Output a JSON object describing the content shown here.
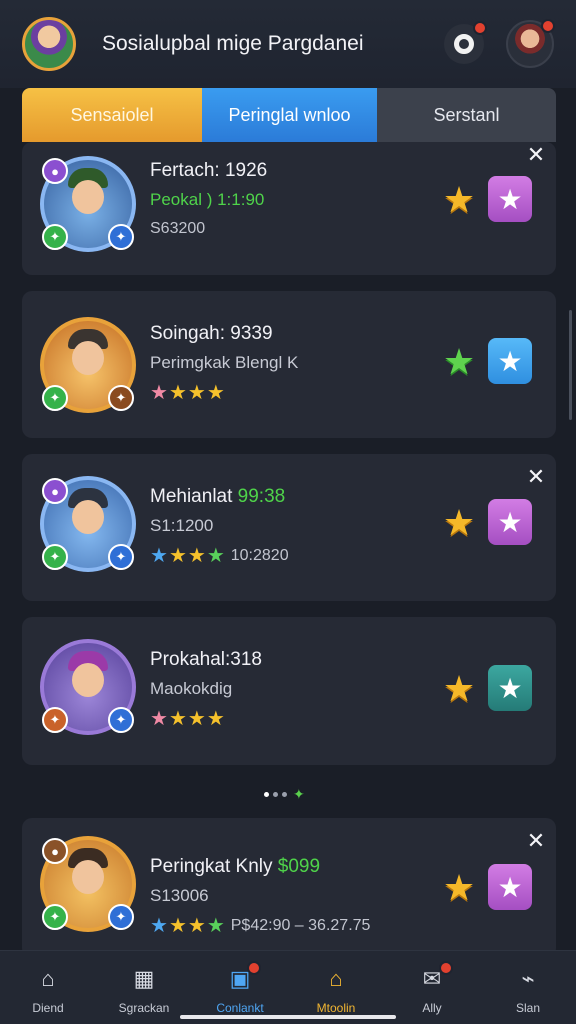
{
  "header": {
    "title": "Sosialupbal mige Pargdanei",
    "avatar_icon": "hero-avatar-icon",
    "settings_icon": "gear-icon",
    "profile_icon": "profile-avatar-icon"
  },
  "tabs": [
    {
      "label": "Sensaiolel"
    },
    {
      "label": "Peringlal wnloo"
    },
    {
      "label": "Serstanl"
    }
  ],
  "cards": [
    {
      "line1": "Fertach: 1926",
      "line2": "Peokal ) 1:1:90",
      "line3_text": "S63200",
      "action_icon": "gold-star-icon",
      "fav_color": "#b85fd4",
      "has_close": true
    },
    {
      "line1": "Soingah: 9339",
      "line2": "Perimgkak Blengl K",
      "line3_text": "",
      "action_icon": "green-star-icon",
      "fav_color": "#3a9eea",
      "has_close": false
    },
    {
      "line1_prefix": "Mehianlat ",
      "line1_green": "99:38",
      "line2": "S1:1200",
      "line3_text": "10:2820",
      "action_icon": "gold-star-icon",
      "fav_color": "#b85fd4",
      "has_close": true
    },
    {
      "line1": "Prokahal:318",
      "line2": "Maokokdig",
      "line3_text": "",
      "action_icon": "gold-star-icon",
      "fav_color": "#2f8f8a",
      "has_close": false
    },
    {
      "line1_prefix": "Peringkat Knly ",
      "line1_green": "$099",
      "line2": "S13006",
      "line3_text": "P$42:90 – 36.27.75",
      "action_icon": "gold-star-icon",
      "fav_color": "#b85fd4",
      "has_close": true
    }
  ],
  "pager": {
    "pages": 3,
    "active": 0
  },
  "nav": [
    {
      "label": "Diend",
      "icon": "home-icon"
    },
    {
      "label": "Sgrackan",
      "icon": "calendar-icon"
    },
    {
      "label": "Conlankt",
      "icon": "contact-icon"
    },
    {
      "label": "Mtoolin",
      "icon": "chest-icon"
    },
    {
      "label": "Ally",
      "icon": "mail-icon"
    },
    {
      "label": "Slan",
      "icon": "signal-icon"
    }
  ],
  "nav_active_index": 2,
  "nav_gold_index": 3,
  "colors": {
    "accent_blue": "#3a9cf0",
    "accent_gold": "#f5c12c",
    "green_text": "#4fd34a",
    "background": "#1a1e27",
    "card": "#262a35"
  }
}
